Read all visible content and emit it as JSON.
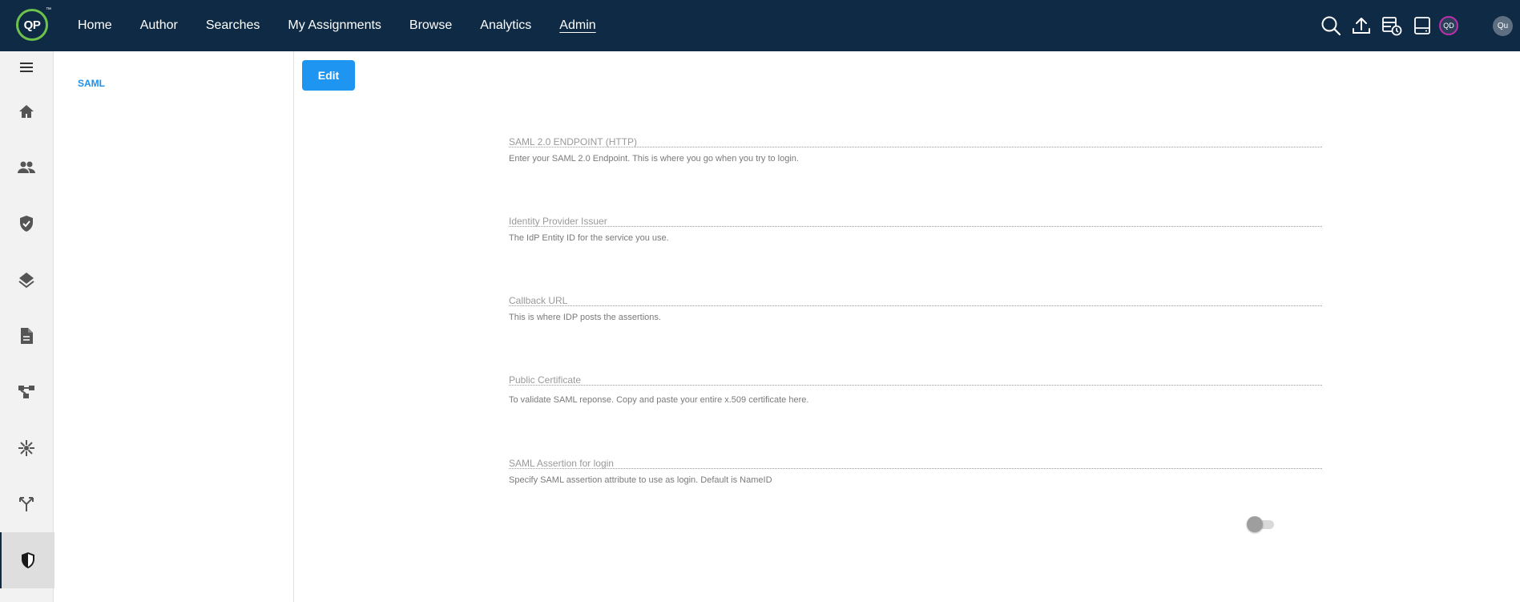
{
  "brand": {
    "logo_text": "QP",
    "trademark": "™"
  },
  "nav": {
    "items": [
      "Home",
      "Author",
      "Searches",
      "My Assignments",
      "Browse",
      "Analytics",
      "Admin"
    ],
    "active": "Admin"
  },
  "top_icons": [
    "search-icon",
    "upload-icon",
    "scheduled-jobs-icon",
    "tray-icon"
  ],
  "avatars": {
    "qd": "QD",
    "user": "Qu"
  },
  "rail": {
    "items": [
      "menu-icon",
      "home-icon",
      "people-icon",
      "shield-check-icon",
      "layers-icon",
      "document-icon",
      "workflow-icon",
      "hub-icon",
      "merge-icon",
      "admin-shield-icon"
    ],
    "active": "admin-shield-icon"
  },
  "subnav": {
    "label": "SAML"
  },
  "toolbar": {
    "edit_label": "Edit"
  },
  "fields": [
    {
      "label": "SAML 2.0 ENDPOINT (HTTP)",
      "help": "Enter your SAML 2.0 Endpoint. This is where you go when you try to login."
    },
    {
      "label": "Identity Provider Issuer",
      "help": "The IdP Entity ID for the service you use."
    },
    {
      "label": "Callback URL",
      "help": "This is where IDP posts the assertions."
    },
    {
      "label": "Public Certificate",
      "help": "To validate SAML reponse. Copy and paste your entire x.509 certificate here."
    },
    {
      "label": "SAML Assertion for login",
      "help": "Specify SAML assertion attribute to use as login. Default is NameID"
    }
  ],
  "toggle": {
    "on": false
  },
  "colors": {
    "topbar": "#0f2a44",
    "accent": "#1e95f0",
    "logo_ring": "#6cc24a"
  }
}
